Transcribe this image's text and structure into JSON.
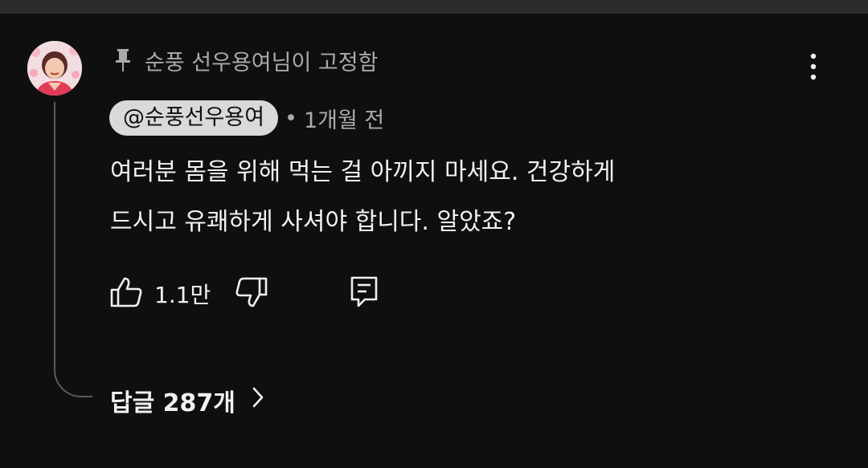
{
  "comment": {
    "pinned_label": "순풍 선우용여님이 고정함",
    "author_handle": "@순풍선우용여",
    "time_separator": "•",
    "time_ago": "1개월 전",
    "text_lines": [
      "여러분 몸을 위해 먹는 걸 아끼지 마세요. 건강하게",
      "드시고 유쾌하게 사셔야 합니다. 알았죠?"
    ],
    "like_count": "1.1만",
    "replies_label": "답글 287개"
  },
  "icons": {
    "pin": "pin-icon",
    "more": "more-vertical-icon",
    "like": "thumbs-up-icon",
    "dislike": "thumbs-down-icon",
    "reply": "reply-comment-icon",
    "chevron": "chevron-right-icon"
  },
  "colors": {
    "background": "#0f0f0f",
    "text_primary": "#f1f1f1",
    "text_secondary": "#aaaaaa",
    "author_chip": "#d9d9d9",
    "thread_line": "#5a5a5a"
  }
}
